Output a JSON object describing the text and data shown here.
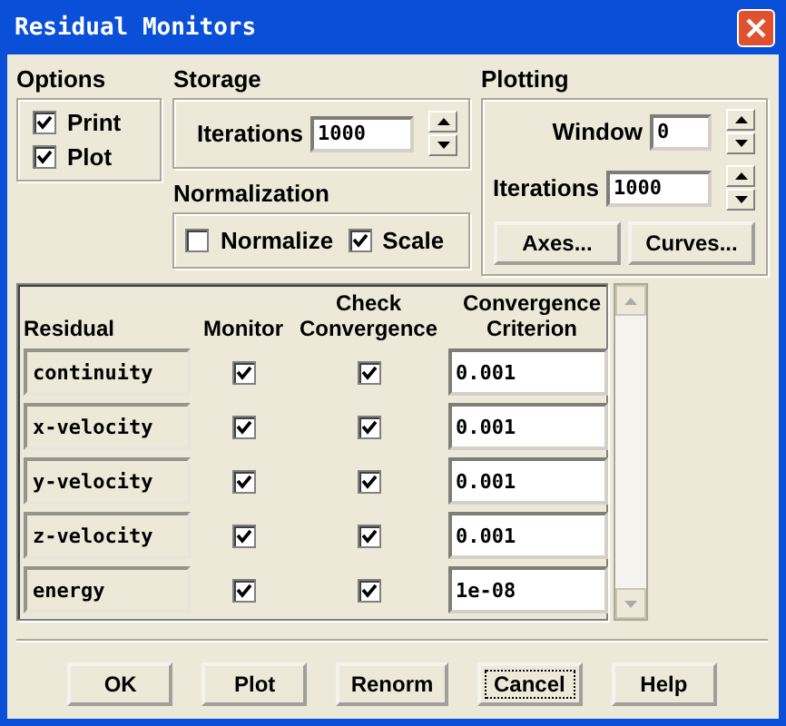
{
  "window": {
    "title": "Residual Monitors"
  },
  "options": {
    "title": "Options",
    "items": [
      {
        "label": "Print",
        "checked": true
      },
      {
        "label": "Plot",
        "checked": true
      }
    ]
  },
  "storage": {
    "title": "Storage",
    "label": "Iterations",
    "value": "1000"
  },
  "normalization": {
    "title": "Normalization",
    "items": [
      {
        "label": "Normalize",
        "checked": false
      },
      {
        "label": "Scale",
        "checked": true
      }
    ]
  },
  "plotting": {
    "title": "Plotting",
    "fields": [
      {
        "label": "Window",
        "value": "0"
      },
      {
        "label": "Iterations",
        "value": "1000"
      }
    ],
    "buttons": [
      "Axes...",
      "Curves..."
    ]
  },
  "table": {
    "columns": [
      "Residual",
      "Monitor",
      "Check Convergence",
      "Convergence Criterion"
    ],
    "rows": [
      {
        "name": "continuity",
        "monitor": true,
        "check": true,
        "criterion": "0.001"
      },
      {
        "name": "x-velocity",
        "monitor": true,
        "check": true,
        "criterion": "0.001"
      },
      {
        "name": "y-velocity",
        "monitor": true,
        "check": true,
        "criterion": "0.001"
      },
      {
        "name": "z-velocity",
        "monitor": true,
        "check": true,
        "criterion": "0.001"
      },
      {
        "name": "energy",
        "monitor": true,
        "check": true,
        "criterion": "1e-08"
      }
    ]
  },
  "buttons": [
    {
      "label": "OK",
      "focused": false
    },
    {
      "label": "Plot",
      "focused": false
    },
    {
      "label": "Renorm",
      "focused": false
    },
    {
      "label": "Cancel",
      "focused": true
    },
    {
      "label": "Help",
      "focused": false
    }
  ]
}
